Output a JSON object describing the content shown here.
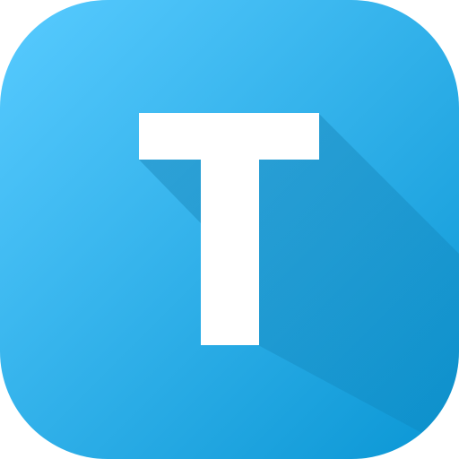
{
  "app_icon": {
    "glyph": "T",
    "icon_name": "letter-t-app-icon",
    "colors": {
      "gradient_start": "#58CBFF",
      "gradient_end": "#0A96D4",
      "long_shadow": "#0B6FA0",
      "glyph": "#FFFFFF"
    }
  }
}
